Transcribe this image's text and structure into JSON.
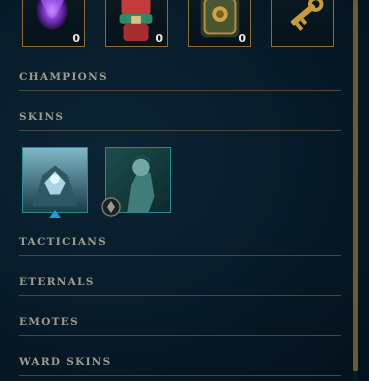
{
  "loot": [
    {
      "name": "mystery-orb",
      "count": "0"
    },
    {
      "name": "capsule",
      "count": "0"
    },
    {
      "name": "chest",
      "count": "0"
    },
    {
      "name": "key",
      "count": ""
    }
  ],
  "sections": {
    "champions": "CHAMPIONS",
    "skins": "SKINS",
    "tacticians": "TACTICIANS",
    "eternals": "ETERNALS",
    "emotes": "EMOTES",
    "ward_skins": "WARD SKINS"
  },
  "skins": [
    {
      "name": "skin-1",
      "badge": "selected-triangle"
    },
    {
      "name": "skin-2",
      "badge": "chroma-icon"
    }
  ],
  "colors": {
    "gold_border": "#8a6d3b",
    "header_text": "#a09b8c",
    "skin_border": "#2a8a90",
    "divider": "#4a4a3c",
    "accent_blue": "#1e9bd7"
  }
}
